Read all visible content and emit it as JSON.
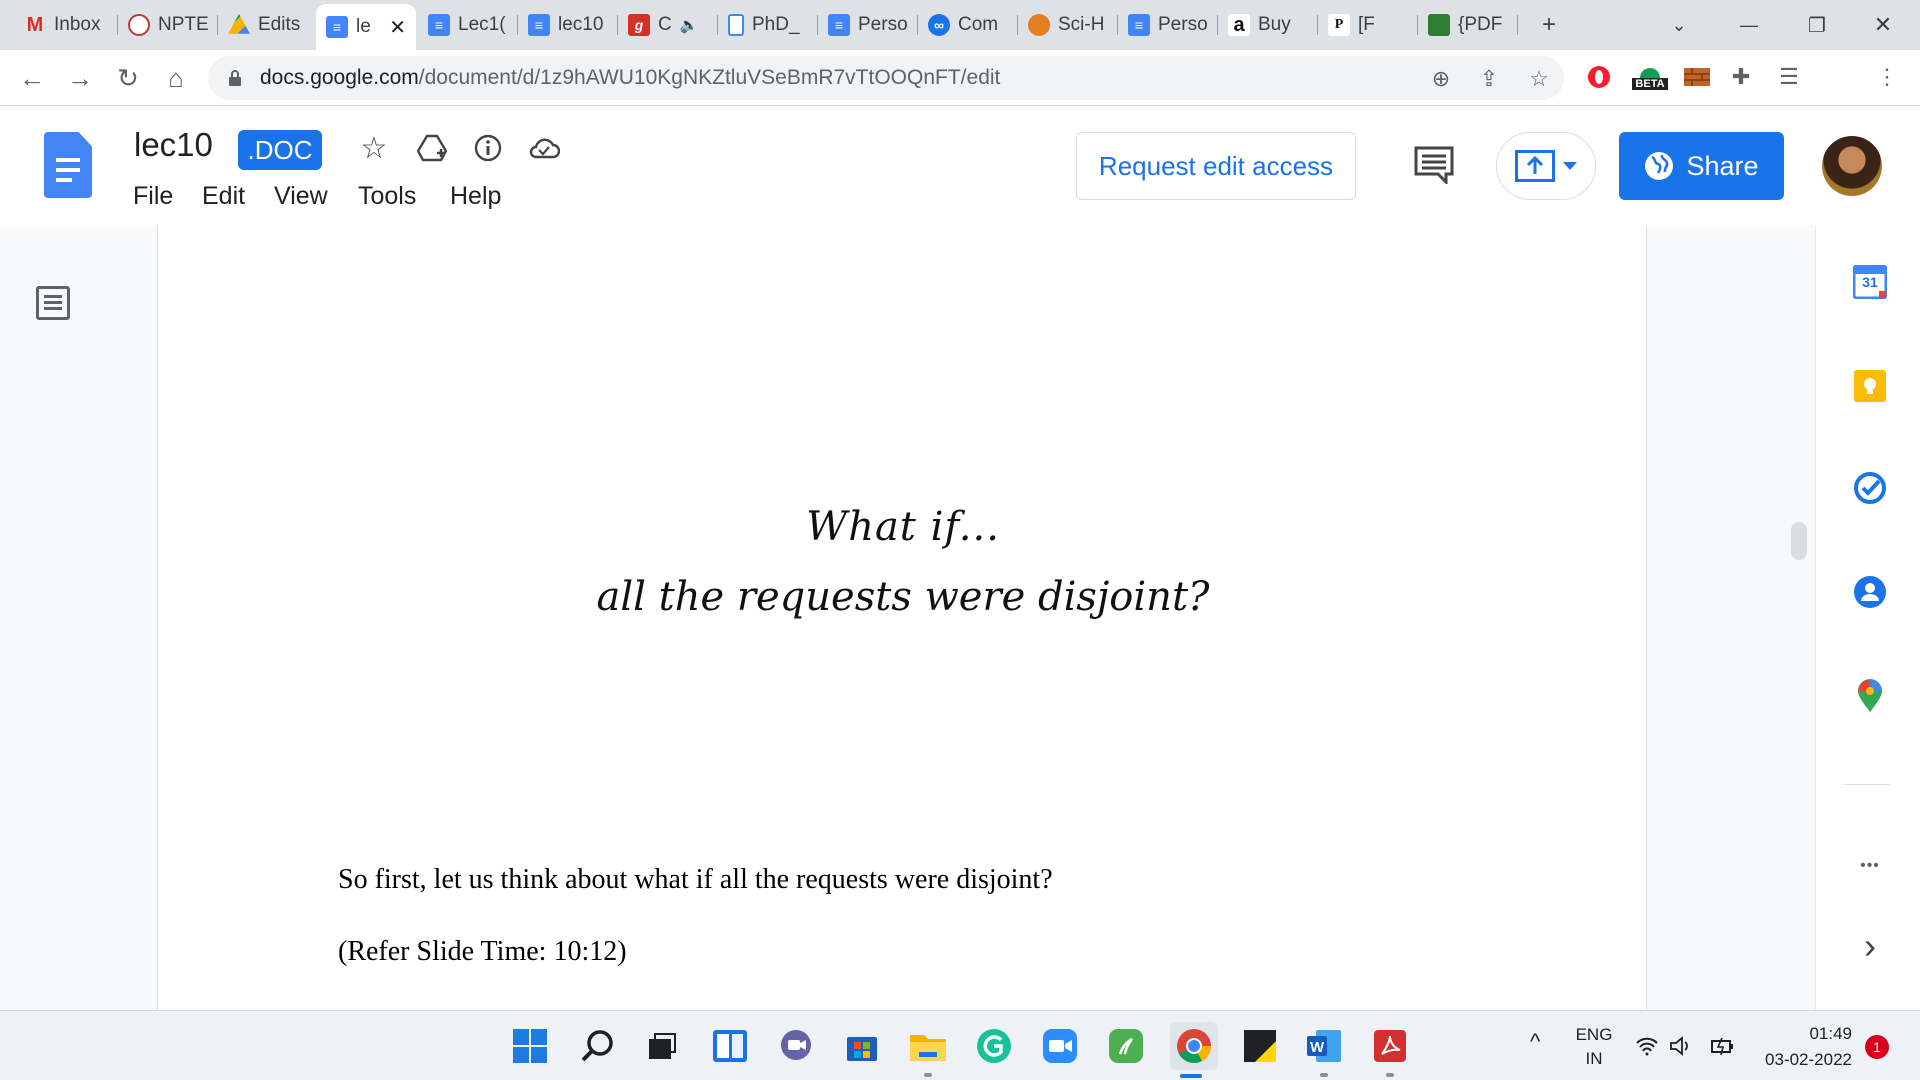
{
  "browser": {
    "tabs": [
      {
        "label": "Inbox",
        "icon": "gmail-icon"
      },
      {
        "label": "NPTE",
        "icon": "nptel-icon"
      },
      {
        "label": "Edits",
        "icon": "drive-icon"
      },
      {
        "label": "le",
        "icon": "docs-icon",
        "active": true
      },
      {
        "label": "Lec1(",
        "icon": "docs-icon"
      },
      {
        "label": "lec10",
        "icon": "docs-icon"
      },
      {
        "label": "C",
        "icon": "g-icon"
      },
      {
        "label": "PhD_",
        "icon": "file-icon"
      },
      {
        "label": "Perso",
        "icon": "docs-icon"
      },
      {
        "label": "Com",
        "icon": "link-icon"
      },
      {
        "label": "Sci-H",
        "icon": "scihub-icon"
      },
      {
        "label": "Perso",
        "icon": "docs-icon"
      },
      {
        "label": "Buy",
        "icon": "amazon-icon"
      },
      {
        "label": "[F",
        "icon": "p-icon"
      },
      {
        "label": "{PDF",
        "icon": "pdf-site-icon"
      }
    ],
    "tab_close_glyph": "✕",
    "speaker_glyph": "🔈",
    "new_tab_glyph": "+",
    "url_domain": "docs.google.com",
    "url_path": "/document/d/1z9hAWU10KgNKZtluVSeBmR7vTtOOQnFT/edit",
    "beta_label": "BETA",
    "favicon_letters": {
      "amazon": "a",
      "p": "P",
      "g": "g"
    }
  },
  "doc_header": {
    "title": "lec10",
    "badge": ".DOC",
    "menu": [
      "File",
      "Edit",
      "View",
      "Tools",
      "Help"
    ],
    "request_edit_label": "Request edit access",
    "share_label": "Share"
  },
  "document": {
    "script_line1": "What if...",
    "script_line2": "all the requests were disjoint?",
    "paragraph1": "So first, let us think about what if all the requests were disjoint?",
    "paragraph2": "(Refer Slide Time: 10:12)"
  },
  "side_panel": {
    "calendar_day": "31",
    "more_glyph": "•••",
    "expand_glyph": "›"
  },
  "taskbar": {
    "lang_line1": "ENG",
    "lang_line2": "IN",
    "time": "01:49",
    "date": "03-02-2022",
    "notification_count": "1",
    "up_arrow_glyph": "^"
  },
  "colors": {
    "accent": "#1a73e8",
    "docs_blue": "#4285f4",
    "tabstrip": "#dee1e6"
  }
}
